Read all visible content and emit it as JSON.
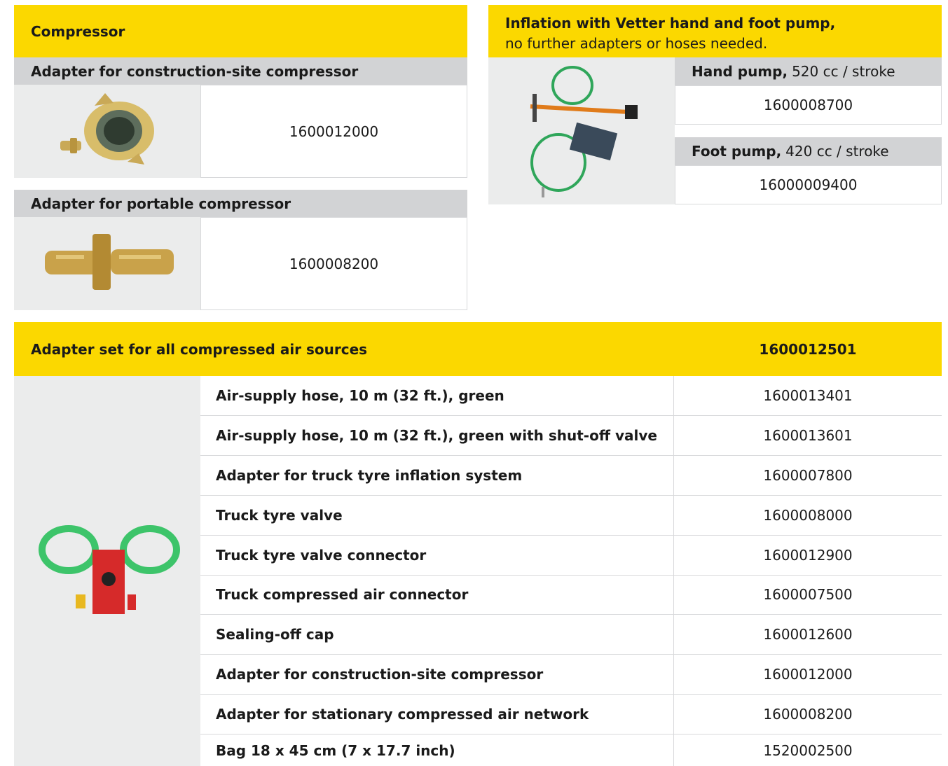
{
  "compressor": {
    "title": "Compressor",
    "construction": {
      "label": "Adapter for construction-site compressor",
      "number": "1600012000"
    },
    "portable": {
      "label": "Adapter for portable compressor",
      "number": "1600008200"
    }
  },
  "pump": {
    "title_bold": "Inflation with Vetter hand and foot pump,",
    "title_rest": "no further adapters or hoses needed.",
    "hand": {
      "name": "Hand pump,",
      "spec": "520 cc / stroke",
      "number": "1600008700"
    },
    "foot": {
      "name": "Foot pump,",
      "spec": "420 cc / stroke",
      "number": "16000009400"
    }
  },
  "set": {
    "title": "Adapter set for all compressed air sources",
    "number": "1600012501",
    "items": [
      {
        "label": "Air-supply hose, 10 m (32 ft.), green",
        "number": "1600013401"
      },
      {
        "label": "Air-supply hose, 10 m (32 ft.), green with shut-off valve",
        "number": "1600013601"
      },
      {
        "label": "Adapter for truck tyre inflation system",
        "number": "1600007800"
      },
      {
        "label": "Truck tyre valve",
        "number": "1600008000"
      },
      {
        "label": "Truck tyre valve connector",
        "number": "1600012900"
      },
      {
        "label": "Truck compressed air connector",
        "number": "1600007500"
      },
      {
        "label": "Sealing-off cap",
        "number": "1600012600"
      },
      {
        "label": "Adapter for construction-site compressor",
        "number": "1600012000"
      },
      {
        "label": "Adapter for stationary compressed air network",
        "number": "1600008200"
      },
      {
        "label": "Bag 18 x 45 cm (7 x 17.7 inch)",
        "number": "1520002500"
      }
    ]
  },
  "colors": {
    "accent": "#fbd800",
    "header_grey": "#d2d3d5",
    "image_bg": "#ebecec"
  },
  "icons": [
    "claw-coupling-image",
    "brass-nipple-image",
    "pump-set-image",
    "hose-set-image"
  ]
}
